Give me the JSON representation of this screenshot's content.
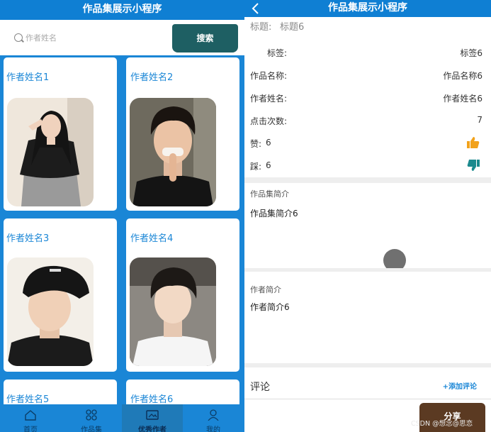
{
  "left_screen": {
    "title": "作品集展示小程序",
    "search": {
      "placeholder": "作者姓名",
      "button_label": "搜索"
    },
    "cards": [
      {
        "author": "作者姓名1"
      },
      {
        "author": "作者姓名2"
      },
      {
        "author": "作者姓名3"
      },
      {
        "author": "作者姓名4"
      },
      {
        "author": "作者姓名5"
      },
      {
        "author": "作者姓名6"
      }
    ],
    "tabbar": [
      {
        "label": "首页",
        "icon": "home-icon"
      },
      {
        "label": "作品集",
        "icon": "collection-icon"
      },
      {
        "label": "优秀作者",
        "icon": "author-icon",
        "active": true
      },
      {
        "label": "我的",
        "icon": "profile-icon"
      }
    ]
  },
  "right_screen": {
    "title": "作品集展示小程序",
    "title_row": {
      "label": "标题:",
      "value": "标题6"
    },
    "details": [
      {
        "label": "标签:",
        "value": "标签6"
      },
      {
        "label": "作品名称:",
        "value": "作品名称6"
      },
      {
        "label": "作者姓名:",
        "value": "作者姓名6"
      },
      {
        "label": "点击次数:",
        "value": "7"
      }
    ],
    "likes": {
      "label": "赞:",
      "count": "6",
      "icon": "thumbs-up-icon"
    },
    "dislikes": {
      "label": "踩:",
      "count": "6",
      "icon": "thumbs-down-icon"
    },
    "intro": {
      "label": "作品集简介",
      "text": "作品集简介6"
    },
    "author_intro": {
      "label": "作者简介",
      "text": "作者简介6"
    },
    "comments": {
      "label": "评论",
      "add_label": "+添加评论"
    },
    "share_label": "分享",
    "watermark": "CSDN @想念@思恋"
  },
  "colors": {
    "primary": "#0f7fd3",
    "search_button": "#1e5f63",
    "like": "#f2a21b",
    "dislike": "#1b8a8e",
    "share": "#5b3a22"
  }
}
